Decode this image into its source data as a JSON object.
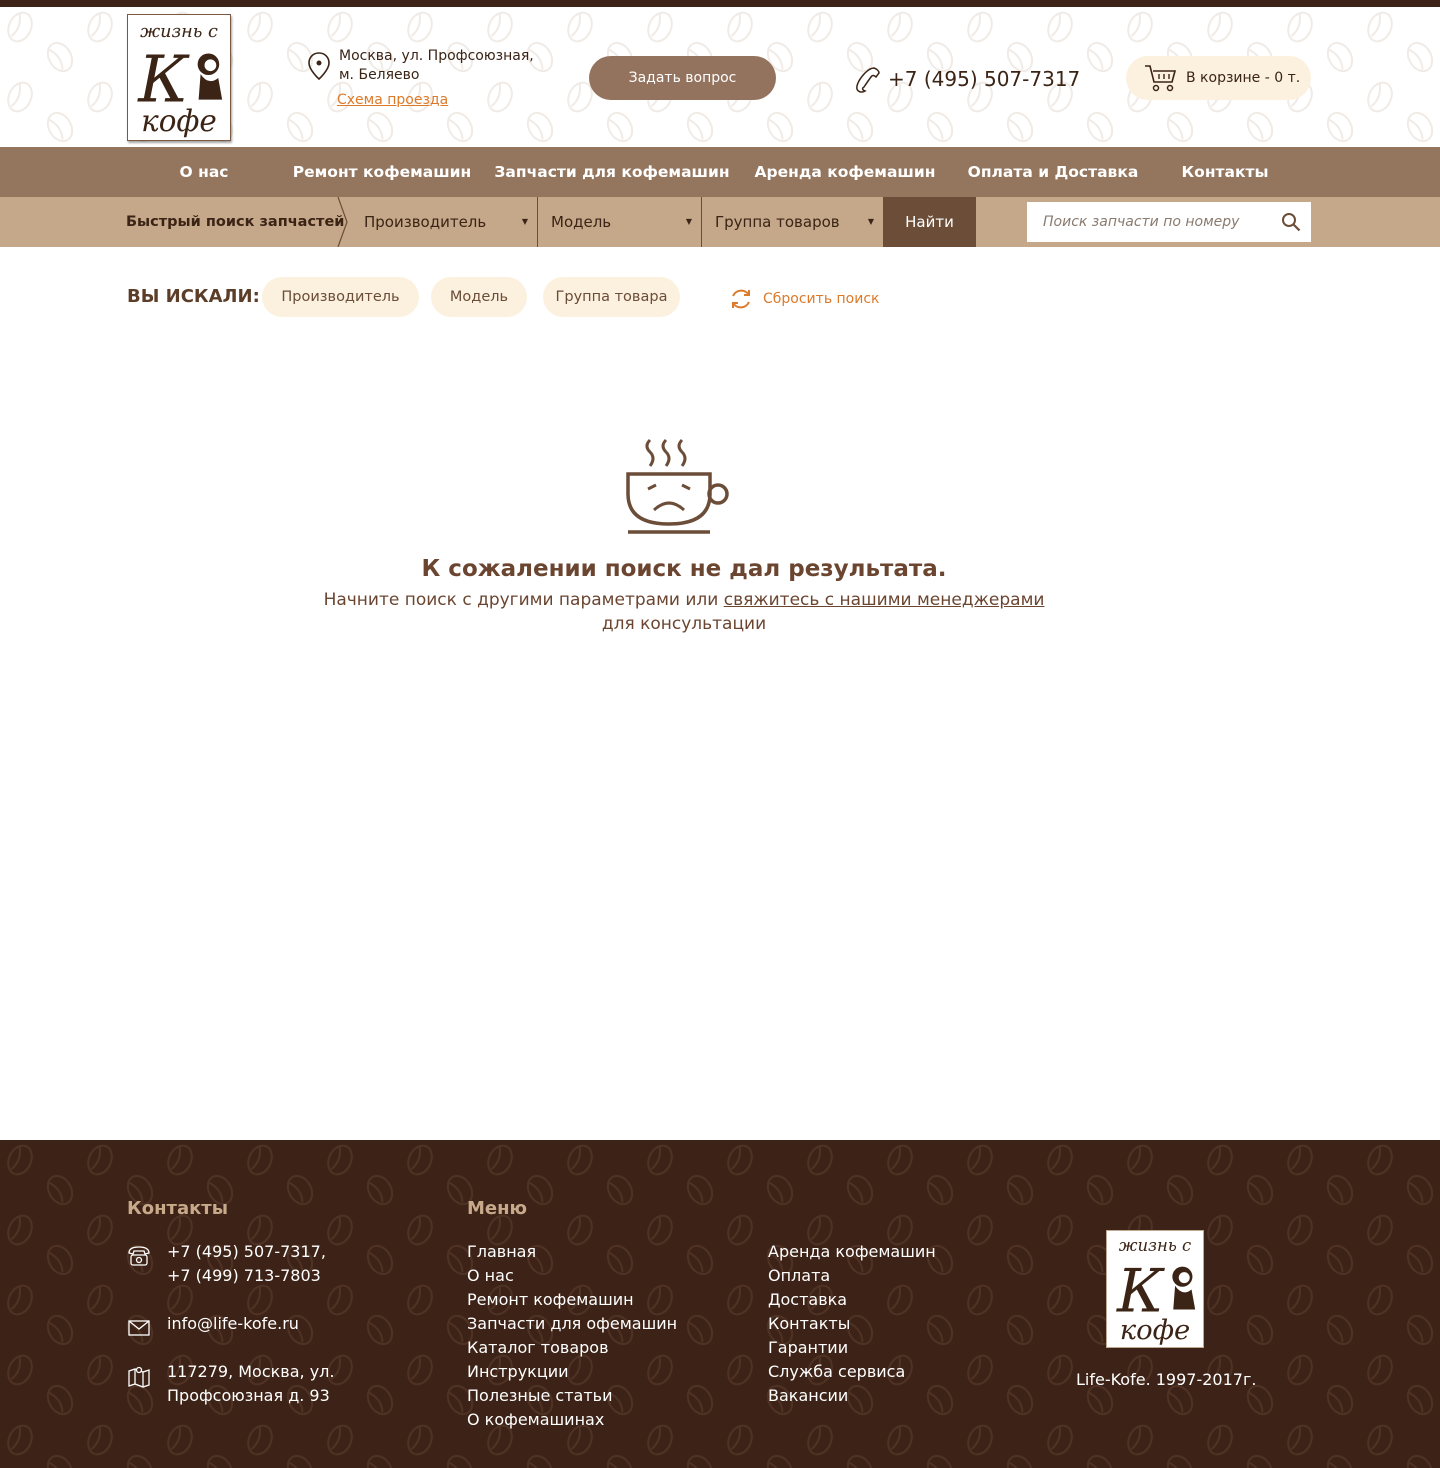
{
  "header": {
    "logo": {
      "line1": "жизнь с",
      "letter": "К",
      "line2": "кофе"
    },
    "address_line1": "Москва, ул. Профсоюзная,",
    "address_line2": "м. Беляево",
    "map_link": "Схема проезда",
    "ask_button": "Задать вопрос",
    "phone": "+7 (495) 507-7317",
    "cart": "В корзине - 0 т."
  },
  "nav": {
    "items": [
      {
        "label": "О нас"
      },
      {
        "label": "Ремонт кофемашин"
      },
      {
        "label": "Запчасти для кофемашин"
      },
      {
        "label": "Аренда кофемашин"
      },
      {
        "label": "Оплата и Доставка"
      },
      {
        "label": "Контакты"
      }
    ]
  },
  "quick_search": {
    "label": "Быстрый поиск запчастей",
    "manufacturer": "Производитель",
    "model": "Модель",
    "group": "Группа товаров",
    "find_button": "Найти",
    "number_placeholder": "Поиск запчасти по номеру"
  },
  "searched": {
    "label": "ВЫ ИСКАЛИ:",
    "chips": [
      {
        "label": "Производитель"
      },
      {
        "label": "Модель"
      },
      {
        "label": "Группа товара"
      }
    ],
    "reset": "Сбросить поиск"
  },
  "empty": {
    "title": "К сожалении поиск не дал результата.",
    "text_before": "Начните поиск с другими параметрами или ",
    "link": "свяжитесь с нашими менеджерами",
    "text_after": "для консультации"
  },
  "footer": {
    "contacts_title": "Контакты",
    "phone1": "+7 (495) 507-7317,",
    "phone2": "+7 (499) 713-7803",
    "email": "info@life-kofe.ru",
    "address1": "117279, Москва, ул.",
    "address2": "Профсоюзная д. 93",
    "menu_title": "Меню",
    "menu_col1": [
      "Главная",
      "О нас",
      "Ремонт кофемашин",
      "Запчасти для офемашин",
      "Каталог товаров",
      "Инструкции",
      "Полезные статьи",
      "О кофемашинах"
    ],
    "menu_col2": [
      "Аренда кофемашин",
      "Оплата",
      "Доставка",
      "Контакты",
      "Гарантии",
      "Служба сервиса",
      "Вакансии"
    ],
    "copyright": "Life-Kofe. 1997-2017г."
  },
  "colors": {
    "top_strip": "#3d2317",
    "nav_bg": "#94765f",
    "search_bar_bg": "#c5a88a",
    "find_button": "#6b4d38",
    "accent_orange": "#dd7a2a",
    "chip_bg": "#fbf1de",
    "footer_bg": "#3d2317"
  },
  "icons": [
    "location-pin-icon",
    "phone-handset-icon",
    "cart-icon",
    "search-icon",
    "refresh-icon",
    "sad-coffee-cup-icon",
    "telephone-icon",
    "envelope-icon",
    "map-icon"
  ]
}
